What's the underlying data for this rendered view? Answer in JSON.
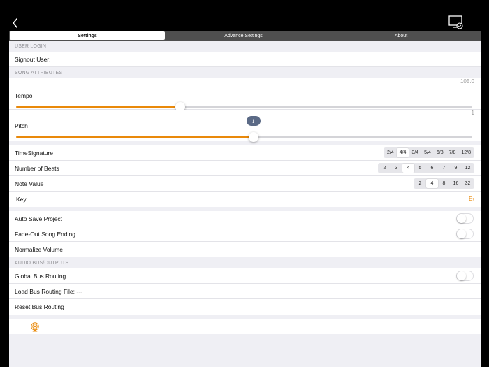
{
  "tabs": [
    {
      "label": "Settings",
      "active": true
    },
    {
      "label": "Advance Settings",
      "active": false
    },
    {
      "label": "About",
      "active": false
    }
  ],
  "user_login": {
    "header": "USER LOGIN",
    "signout_label": "Signout User:"
  },
  "song_attributes": {
    "header": "SONG ATTRIBUTES",
    "tempo": {
      "label": "Tempo",
      "value": "105.0",
      "fraction": 0.36
    },
    "pitch": {
      "label": "Pitch",
      "value": "1",
      "bubble": "1",
      "fraction": 0.52
    },
    "time_signature": {
      "label": "TimeSignature",
      "options": [
        "2/4",
        "4/4",
        "3/4",
        "5/4",
        "6/8",
        "7/8",
        "12/8"
      ],
      "selected": "4/4"
    },
    "number_of_beats": {
      "label": "Number of Beats",
      "options": [
        "2",
        "3",
        "4",
        "5",
        "6",
        "7",
        "9",
        "12"
      ],
      "selected": "4"
    },
    "note_value": {
      "label": "Note Value",
      "options": [
        "2",
        "4",
        "8",
        "16",
        "32"
      ],
      "selected": "4"
    },
    "key": {
      "label": "Key",
      "value": "E"
    },
    "auto_save": {
      "label": "Auto Save Project",
      "on": false
    },
    "fade_out": {
      "label": "Fade-Out Song Ending",
      "on": false
    },
    "normalize": {
      "label": "Normalize Volume"
    }
  },
  "audio_bus": {
    "header": "AUDIO BUS/OUTPUTS",
    "global_routing": {
      "label": "Global Bus Routing",
      "on": false
    },
    "load_file": {
      "label": "Load Bus Routing File: ---"
    },
    "reset": {
      "label": "Reset Bus Routing"
    }
  },
  "icons": {
    "back": "chevron-left-icon",
    "monitor": "monitor-icon",
    "airplay": "airplay-audio-icon"
  },
  "colors": {
    "accent": "#e9890a",
    "tab_bar": "#4f4f4f",
    "background": "#efeff4",
    "bubble": "#5b6a86"
  }
}
